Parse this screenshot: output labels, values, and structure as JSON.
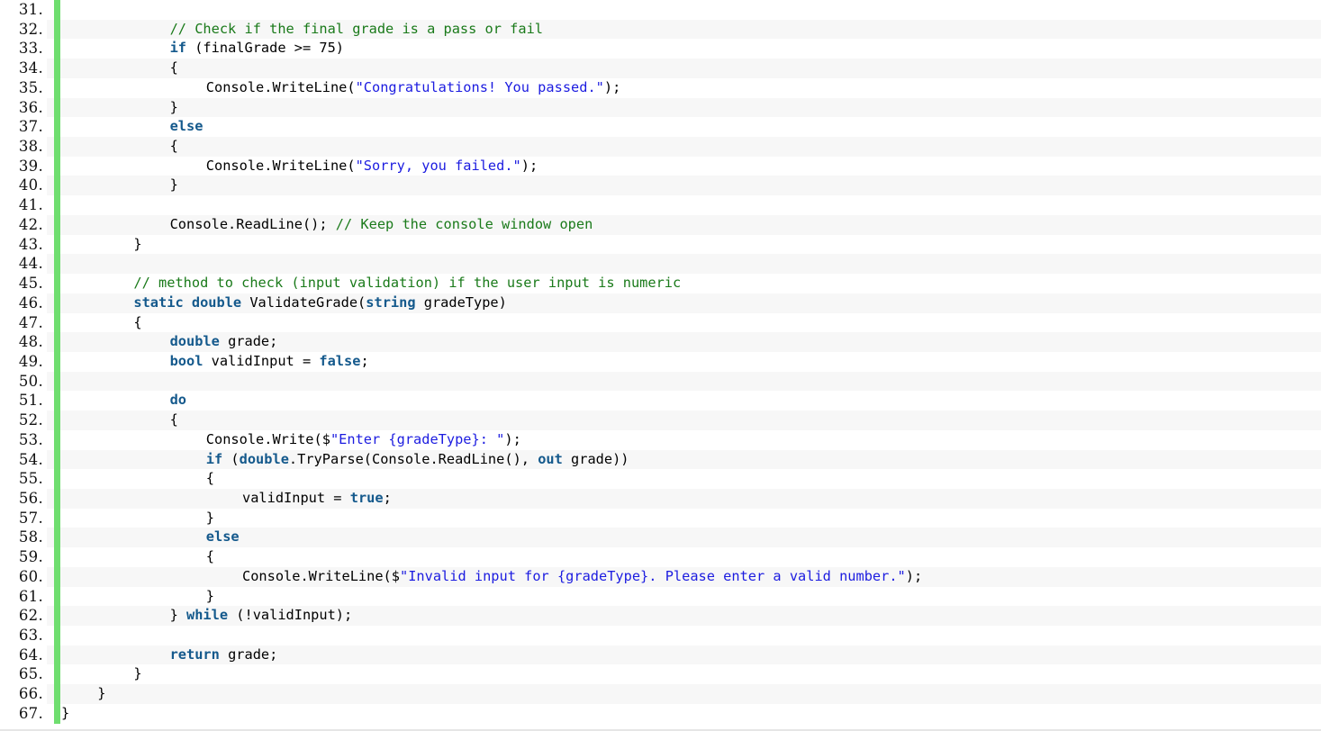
{
  "editor": {
    "language": "csharp",
    "first_line_number": 31,
    "last_line_number": 67,
    "colors": {
      "background": "#ffffff",
      "alt_row_background": "#f7f7f7",
      "gutter_bar": "#6fde6f",
      "keyword": "#14598c",
      "string": "#1c1ce0",
      "comment": "#1a7a1a",
      "plain": "#000000",
      "line_number": "#111111"
    }
  },
  "lines": [
    {
      "number": "31.",
      "indent": 0,
      "tokens": []
    },
    {
      "number": "32.",
      "indent": 12,
      "tokens": [
        {
          "t": "cmt",
          "v": "// Check if the final grade is a pass or fail"
        }
      ]
    },
    {
      "number": "33.",
      "indent": 12,
      "tokens": [
        {
          "t": "kw",
          "v": "if"
        },
        {
          "t": "plain",
          "v": " (finalGrade >= 75)"
        }
      ]
    },
    {
      "number": "34.",
      "indent": 12,
      "tokens": [
        {
          "t": "plain",
          "v": "{"
        }
      ]
    },
    {
      "number": "35.",
      "indent": 16,
      "tokens": [
        {
          "t": "plain",
          "v": "Console.WriteLine("
        },
        {
          "t": "str",
          "v": "\"Congratulations! You passed.\""
        },
        {
          "t": "plain",
          "v": ");"
        }
      ]
    },
    {
      "number": "36.",
      "indent": 12,
      "tokens": [
        {
          "t": "plain",
          "v": "}"
        }
      ]
    },
    {
      "number": "37.",
      "indent": 12,
      "tokens": [
        {
          "t": "kw",
          "v": "else"
        }
      ]
    },
    {
      "number": "38.",
      "indent": 12,
      "tokens": [
        {
          "t": "plain",
          "v": "{"
        }
      ]
    },
    {
      "number": "39.",
      "indent": 16,
      "tokens": [
        {
          "t": "plain",
          "v": "Console.WriteLine("
        },
        {
          "t": "str",
          "v": "\"Sorry, you failed.\""
        },
        {
          "t": "plain",
          "v": ");"
        }
      ]
    },
    {
      "number": "40.",
      "indent": 12,
      "tokens": [
        {
          "t": "plain",
          "v": "}"
        }
      ]
    },
    {
      "number": "41.",
      "indent": 0,
      "tokens": []
    },
    {
      "number": "42.",
      "indent": 12,
      "tokens": [
        {
          "t": "plain",
          "v": "Console.ReadLine(); "
        },
        {
          "t": "cmt",
          "v": "// Keep the console window open"
        }
      ]
    },
    {
      "number": "43.",
      "indent": 8,
      "tokens": [
        {
          "t": "plain",
          "v": "}"
        }
      ]
    },
    {
      "number": "44.",
      "indent": 0,
      "tokens": []
    },
    {
      "number": "45.",
      "indent": 8,
      "tokens": [
        {
          "t": "cmt",
          "v": "// method to check (input validation) if the user input is numeric"
        }
      ]
    },
    {
      "number": "46.",
      "indent": 8,
      "tokens": [
        {
          "t": "kw",
          "v": "static double"
        },
        {
          "t": "plain",
          "v": " ValidateGrade("
        },
        {
          "t": "kw",
          "v": "string"
        },
        {
          "t": "plain",
          "v": " gradeType)"
        }
      ]
    },
    {
      "number": "47.",
      "indent": 8,
      "tokens": [
        {
          "t": "plain",
          "v": "{"
        }
      ]
    },
    {
      "number": "48.",
      "indent": 12,
      "tokens": [
        {
          "t": "kw",
          "v": "double"
        },
        {
          "t": "plain",
          "v": " grade;"
        }
      ]
    },
    {
      "number": "49.",
      "indent": 12,
      "tokens": [
        {
          "t": "kw",
          "v": "bool"
        },
        {
          "t": "plain",
          "v": " validInput = "
        },
        {
          "t": "kw",
          "v": "false"
        },
        {
          "t": "plain",
          "v": ";"
        }
      ]
    },
    {
      "number": "50.",
      "indent": 0,
      "tokens": []
    },
    {
      "number": "51.",
      "indent": 12,
      "tokens": [
        {
          "t": "kw",
          "v": "do"
        }
      ]
    },
    {
      "number": "52.",
      "indent": 12,
      "tokens": [
        {
          "t": "plain",
          "v": "{"
        }
      ]
    },
    {
      "number": "53.",
      "indent": 16,
      "tokens": [
        {
          "t": "plain",
          "v": "Console.Write($"
        },
        {
          "t": "str",
          "v": "\"Enter {gradeType}: \""
        },
        {
          "t": "plain",
          "v": ");"
        }
      ]
    },
    {
      "number": "54.",
      "indent": 16,
      "tokens": [
        {
          "t": "kw",
          "v": "if"
        },
        {
          "t": "plain",
          "v": " ("
        },
        {
          "t": "kw",
          "v": "double"
        },
        {
          "t": "plain",
          "v": ".TryParse(Console.ReadLine(), "
        },
        {
          "t": "kw",
          "v": "out"
        },
        {
          "t": "plain",
          "v": " grade))"
        }
      ]
    },
    {
      "number": "55.",
      "indent": 16,
      "tokens": [
        {
          "t": "plain",
          "v": "{"
        }
      ]
    },
    {
      "number": "56.",
      "indent": 20,
      "tokens": [
        {
          "t": "plain",
          "v": "validInput = "
        },
        {
          "t": "kw",
          "v": "true"
        },
        {
          "t": "plain",
          "v": ";"
        }
      ]
    },
    {
      "number": "57.",
      "indent": 16,
      "tokens": [
        {
          "t": "plain",
          "v": "}"
        }
      ]
    },
    {
      "number": "58.",
      "indent": 16,
      "tokens": [
        {
          "t": "kw",
          "v": "else"
        }
      ]
    },
    {
      "number": "59.",
      "indent": 16,
      "tokens": [
        {
          "t": "plain",
          "v": "{"
        }
      ]
    },
    {
      "number": "60.",
      "indent": 20,
      "tokens": [
        {
          "t": "plain",
          "v": "Console.WriteLine($"
        },
        {
          "t": "str",
          "v": "\"Invalid input for {gradeType}. Please enter a valid number.\""
        },
        {
          "t": "plain",
          "v": ");"
        }
      ]
    },
    {
      "number": "61.",
      "indent": 16,
      "tokens": [
        {
          "t": "plain",
          "v": "}"
        }
      ]
    },
    {
      "number": "62.",
      "indent": 12,
      "tokens": [
        {
          "t": "plain",
          "v": "} "
        },
        {
          "t": "kw",
          "v": "while"
        },
        {
          "t": "plain",
          "v": " (!validInput);"
        }
      ]
    },
    {
      "number": "63.",
      "indent": 0,
      "tokens": []
    },
    {
      "number": "64.",
      "indent": 12,
      "tokens": [
        {
          "t": "kw",
          "v": "return"
        },
        {
          "t": "plain",
          "v": " grade;"
        }
      ]
    },
    {
      "number": "65.",
      "indent": 8,
      "tokens": [
        {
          "t": "plain",
          "v": "}"
        }
      ]
    },
    {
      "number": "66.",
      "indent": 4,
      "tokens": [
        {
          "t": "plain",
          "v": "}"
        }
      ]
    },
    {
      "number": "67.",
      "indent": 0,
      "tokens": [
        {
          "t": "plain",
          "v": "}"
        }
      ]
    }
  ]
}
